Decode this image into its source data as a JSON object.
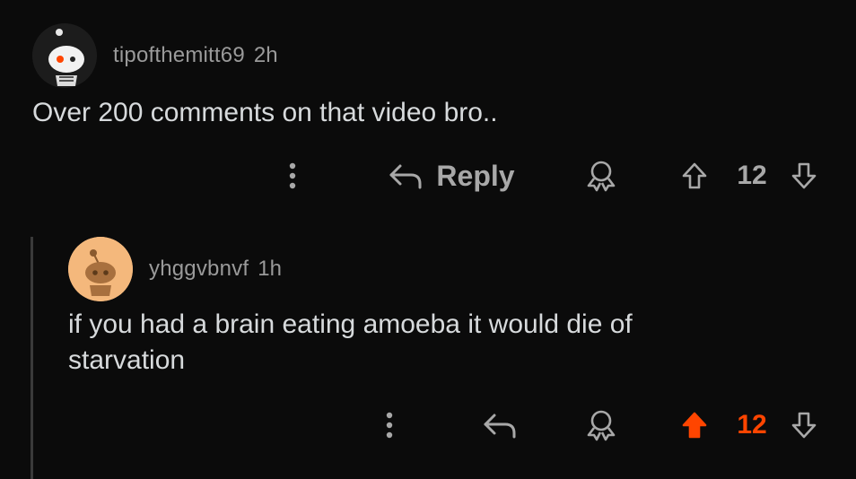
{
  "comment1": {
    "username": "tipofthemitt69",
    "timestamp": "2h",
    "body": "Over 200 comments on that video bro..",
    "reply_label": "Reply",
    "vote_count": "12",
    "upvoted": false
  },
  "comment2": {
    "username": "yhggvbnvf",
    "timestamp": "1h",
    "body_line1": "if you had a brain eating amoeba it would die of",
    "body_line2": "starvation",
    "vote_count": "12",
    "upvoted": true
  },
  "icons": {
    "more": "more-options-icon",
    "reply": "reply-arrow-icon",
    "award": "award-icon",
    "upvote": "upvote-arrow-icon",
    "downvote": "downvote-arrow-icon"
  },
  "colors": {
    "background": "#0b0b0b",
    "text": "#d7dadc",
    "muted": "#9a9a9a",
    "upvote_active": "#ff4500"
  }
}
